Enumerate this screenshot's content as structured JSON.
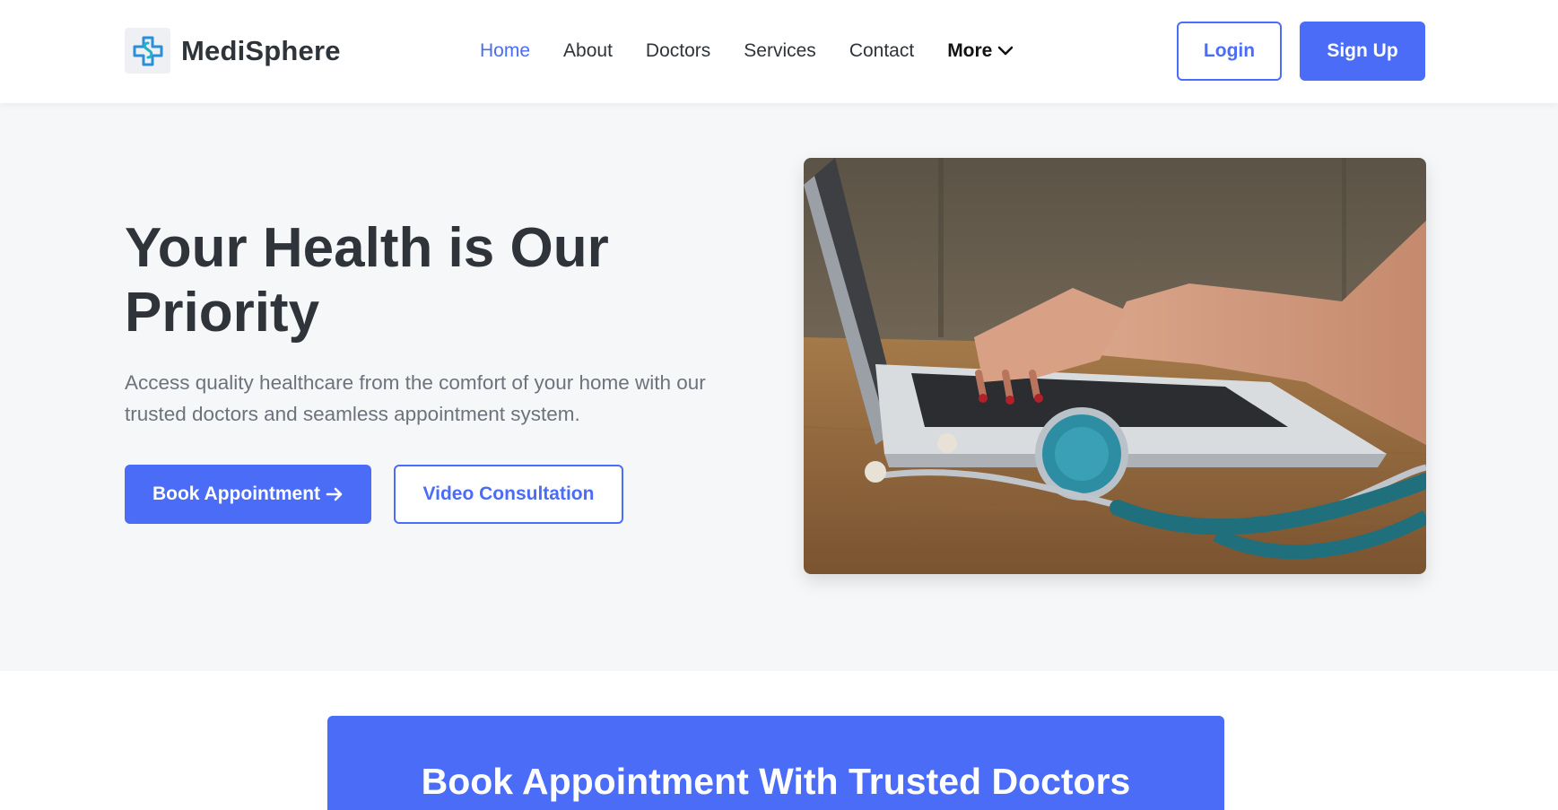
{
  "brand": {
    "name": "MediSphere",
    "logo_icon": "medical-cross-icon"
  },
  "nav": {
    "items": [
      "Home",
      "About",
      "Doctors",
      "Services",
      "Contact"
    ],
    "active": "Home",
    "more_label": "More"
  },
  "auth": {
    "login_label": "Login",
    "signup_label": "Sign Up"
  },
  "hero": {
    "title": "Your Health is Our Priority",
    "subtitle": "Access quality healthcare from the comfort of your home with our trusted doctors and seamless appointment system.",
    "primary_cta": "Book Appointment",
    "secondary_cta": "Video Consultation",
    "image_subject": "laptop-with-stethoscope"
  },
  "banner": {
    "title": "Book Appointment With Trusted Doctors"
  },
  "colors": {
    "accent": "#4a6cf7",
    "text_dark": "#2f343a",
    "text_muted": "#6c737c",
    "hero_bg": "#f6f7f9"
  }
}
